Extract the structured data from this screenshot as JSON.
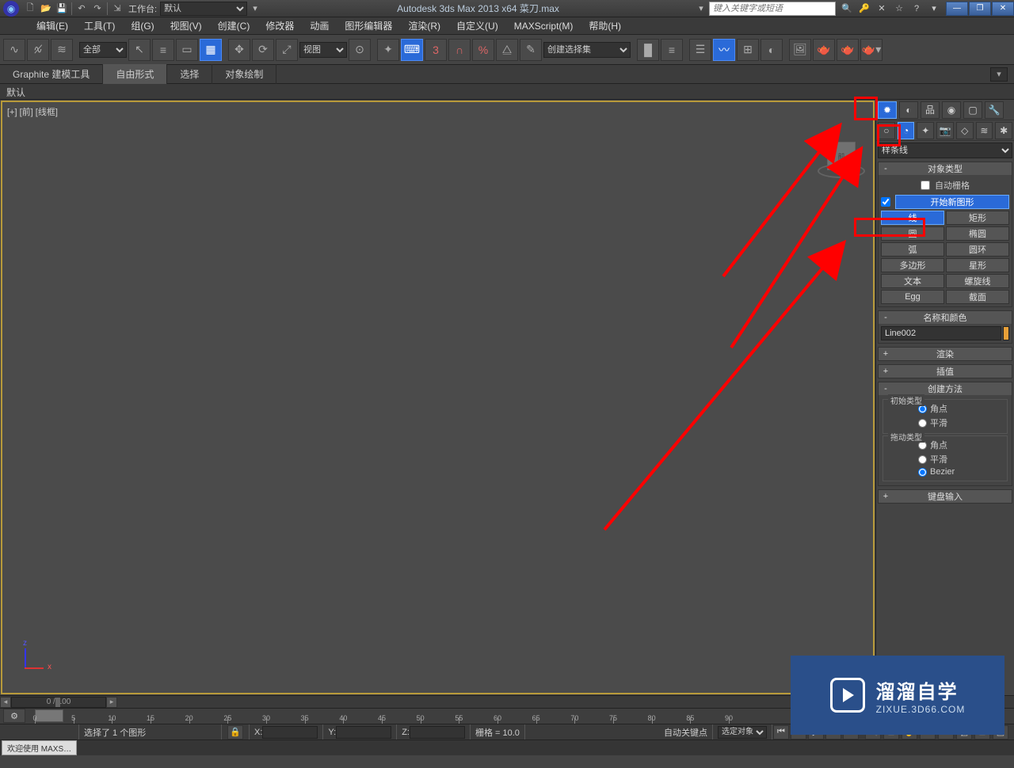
{
  "titlebar": {
    "workspace_label": "工作台:",
    "workspace_value": "默认",
    "app_title": "Autodesk 3ds Max  2013 x64     菜刀.max",
    "search_placeholder": "键入关键字或短语"
  },
  "menu": {
    "items": [
      "编辑(E)",
      "工具(T)",
      "组(G)",
      "视图(V)",
      "创建(C)",
      "修改器",
      "动画",
      "图形编辑器",
      "渲染(R)",
      "自定义(U)",
      "MAXScript(M)",
      "帮助(H)"
    ]
  },
  "toolbar": {
    "filter_all": "全部",
    "ref_coord": "视图",
    "named_sel": "创建选择集"
  },
  "ribbon": {
    "tabs": [
      "Graphite 建模工具",
      "自由形式",
      "选择",
      "对象绘制"
    ],
    "active": 1
  },
  "defaultbar": {
    "label": "默认"
  },
  "viewport": {
    "label": "[+] [前] [线框]",
    "cube_face": "前"
  },
  "hscroll": {
    "range": "0 / 100"
  },
  "timeline": {
    "ticks": [
      0,
      5,
      10,
      15,
      20,
      25,
      30,
      35,
      40,
      45,
      50,
      55,
      60,
      65,
      70,
      75,
      80,
      85,
      90
    ]
  },
  "cmd_panel": {
    "dropdown": "样条线",
    "obj_type": {
      "title": "对象类型",
      "autogrid": "自动栅格",
      "start_new": "开始新图形",
      "buttons": [
        "线",
        "矩形",
        "圆",
        "椭圆",
        "弧",
        "圆环",
        "多边形",
        "星形",
        "文本",
        "螺旋线",
        "Egg",
        "截面"
      ],
      "selected": 0
    },
    "name_color": {
      "title": "名称和颜色",
      "value": "Line002"
    },
    "render": {
      "title": "渲染"
    },
    "interp": {
      "title": "插值"
    },
    "create_method": {
      "title": "创建方法",
      "initial": {
        "label": "初始类型",
        "options": [
          "角点",
          "平滑"
        ],
        "sel": 0
      },
      "drag": {
        "label": "拖动类型",
        "options": [
          "角点",
          "平滑",
          "Bezier"
        ],
        "sel": 2
      }
    },
    "keyboard": {
      "title": "键盘输入"
    }
  },
  "status": {
    "sel_text": "选择了 1 个图形",
    "x_label": "X:",
    "y_label": "Y:",
    "z_label": "Z:",
    "grid_label": "栅格 = 10.0",
    "autokey": "自动关键点",
    "selkey": "选定对象"
  },
  "bottom": {
    "tab": "欢迎使用  MAXS…"
  },
  "watermark": {
    "line1": "溜溜自学",
    "line2": "ZIXUE.3D66.COM"
  }
}
